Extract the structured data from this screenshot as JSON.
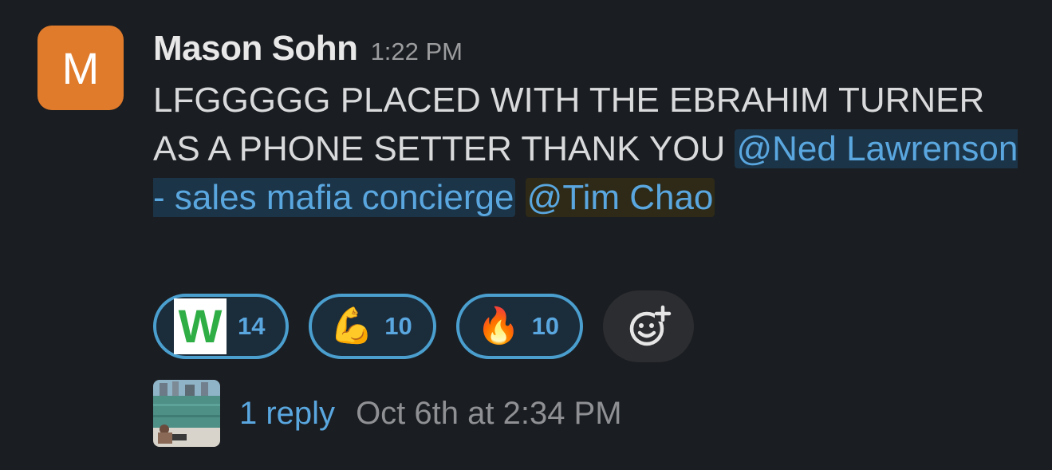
{
  "message": {
    "avatar_initial": "M",
    "avatar_color": "#e07b2c",
    "sender": "Mason Sohn",
    "time": "1:22 PM",
    "text": "LFGGGGG PLACED WITH THE EBRAHIM TURNER AS A PHONE SETTER THANK YOU",
    "mentions": [
      "@Ned Lawrenson - sales mafia concierge",
      "@Tim Chao"
    ]
  },
  "reactions": [
    {
      "icon": "w-letter-icon",
      "glyph": "W",
      "count": "14"
    },
    {
      "icon": "flexed-biceps-icon",
      "glyph": "💪",
      "count": "10"
    },
    {
      "icon": "fire-icon",
      "glyph": "🔥",
      "count": "10"
    }
  ],
  "add_reaction": {
    "icon": "add-reaction-icon"
  },
  "thread": {
    "reply_label": "1 reply",
    "reply_time": "Oct 6th at 2:34 PM"
  },
  "colors": {
    "background": "#1a1d21",
    "link": "#5aa7e0",
    "reaction_border": "#4a9fcf"
  }
}
